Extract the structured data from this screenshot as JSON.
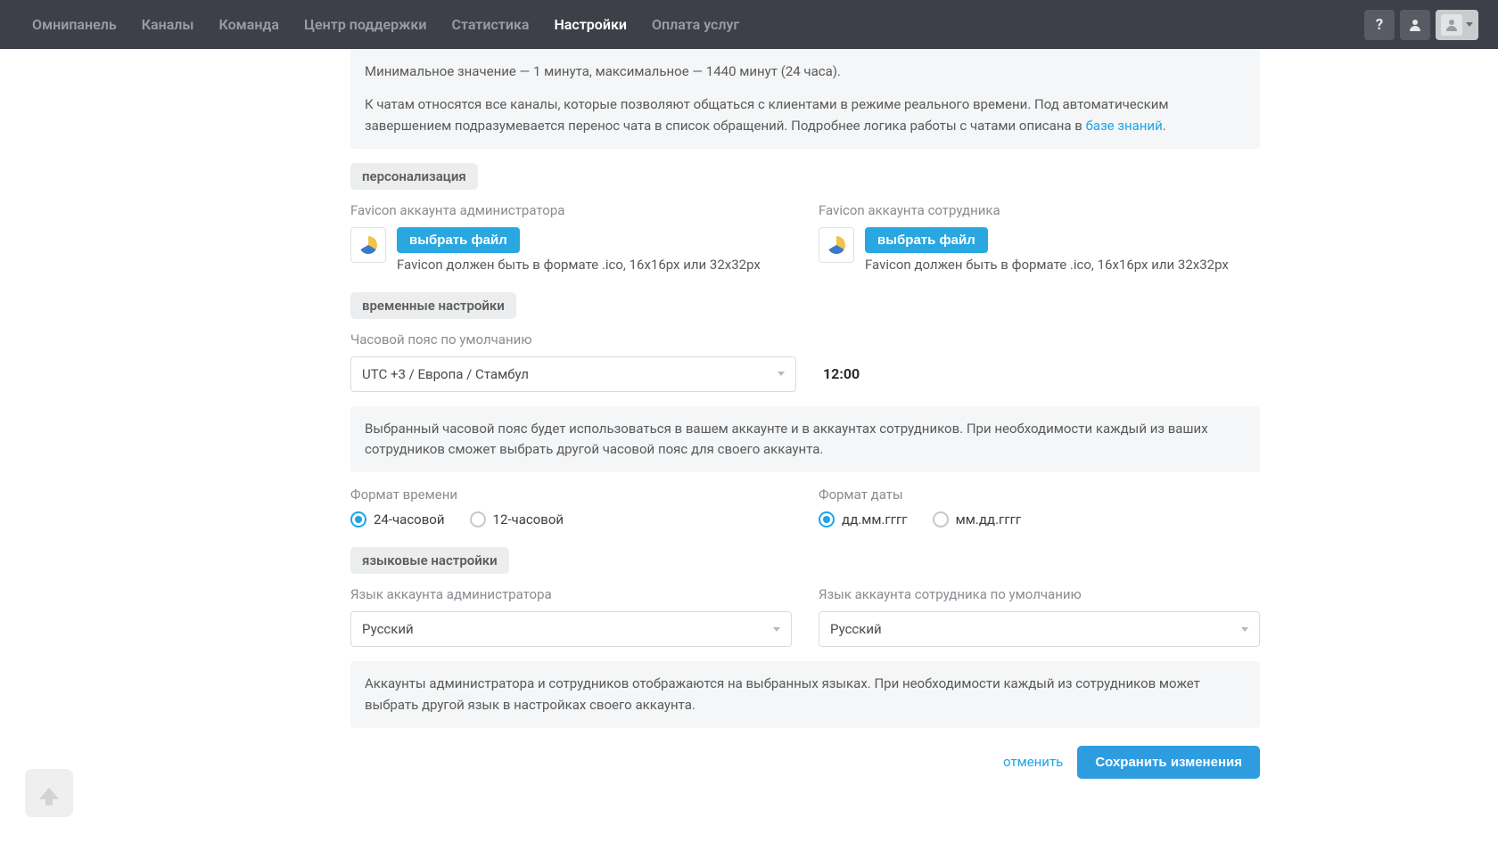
{
  "nav": {
    "items": [
      {
        "label": "Омнипанель"
      },
      {
        "label": "Каналы"
      },
      {
        "label": "Команда"
      },
      {
        "label": "Центр поддержки"
      },
      {
        "label": "Статистика"
      },
      {
        "label": "Настройки",
        "active": true
      },
      {
        "label": "Оплата услуг"
      }
    ]
  },
  "chat_info": {
    "line1": "Минимальное значение — 1 минута, максимальное — 1440 минут (24 часа).",
    "line2_a": "К чатам относятся все каналы, которые позволяют общаться с клиентами в режиме реального времени. Под автоматическим завершением подразумевается перенос чата в список обращений. Подробнее логика работы с чатами описана в ",
    "line2_link": "базе знаний",
    "line2_b": "."
  },
  "personalization": {
    "title": "персонализация",
    "admin_favicon_label": "Favicon аккаунта администратора",
    "employee_favicon_label": "Favicon аккаунта сотрудника",
    "choose_file": "выбрать файл",
    "favicon_hint": "Favicon должен быть в формате .ico, 16x16px или 32х32рх"
  },
  "time_settings": {
    "title": "временные настройки",
    "tz_label": "Часовой пояс по умолчанию",
    "tz_value": "UTC +3 / Европа / Стамбул",
    "time_display": "12:00",
    "tz_info": "Выбранный часовой пояс будет использоваться в вашем аккаунте и в аккаунтах сотрудников. При необходимости каждый из ваших сотрудников сможет выбрать другой часовой пояс для своего аккаунта.",
    "time_format_label": "Формат времени",
    "time_format_options": [
      {
        "label": "24-часовой",
        "selected": true
      },
      {
        "label": "12-часовой",
        "selected": false
      }
    ],
    "date_format_label": "Формат даты",
    "date_format_options": [
      {
        "label": "дд.мм.гггг",
        "selected": true
      },
      {
        "label": "мм.дд.гггг",
        "selected": false
      }
    ]
  },
  "lang_settings": {
    "title": "языковые настройки",
    "admin_lang_label": "Язык аккаунта администратора",
    "admin_lang_value": "Русский",
    "employee_lang_label": "Язык аккаунта сотрудника по умолчанию",
    "employee_lang_value": "Русский",
    "info": "Аккаунты администратора и сотрудников отображаются на выбранных языках. При необходимости каждый из сотрудников может выбрать другой язык в настройках своего аккаунта."
  },
  "footer": {
    "cancel": "отменить",
    "save": "Сохранить изменения"
  },
  "icons": {
    "help": "?"
  }
}
